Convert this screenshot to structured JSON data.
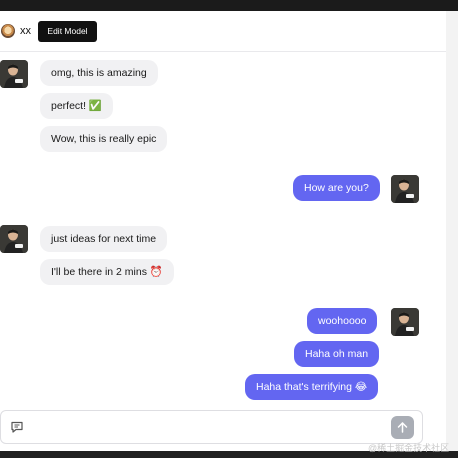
{
  "header": {
    "model_name": "xx",
    "edit_model_label": "Edit Model"
  },
  "messages": [
    {
      "side": "in",
      "text": "omg, this is amazing"
    },
    {
      "side": "in",
      "text": "perfect! ✅"
    },
    {
      "side": "in",
      "text": "Wow, this is really epic"
    },
    {
      "side": "out",
      "text": "How are you?"
    },
    {
      "side": "in",
      "text": "just ideas for next time"
    },
    {
      "side": "in",
      "text": "I'll be there in 2 mins ⏰"
    },
    {
      "side": "out",
      "text": "woohoooo"
    },
    {
      "side": "out",
      "text": "Haha oh man"
    },
    {
      "side": "out",
      "text": "Haha that's terrifying 😂"
    }
  ],
  "composer": {
    "placeholder": "",
    "value": ""
  },
  "watermark": "@稀土掘金技术社区",
  "colors": {
    "outgoing_bubble": "#6366f1",
    "incoming_bubble": "#f1f1f3",
    "edit_button": "#111111",
    "send_button": "#a9adb5"
  },
  "icons": {
    "composer_left": "message-square-icon",
    "send": "arrow-up-icon"
  }
}
